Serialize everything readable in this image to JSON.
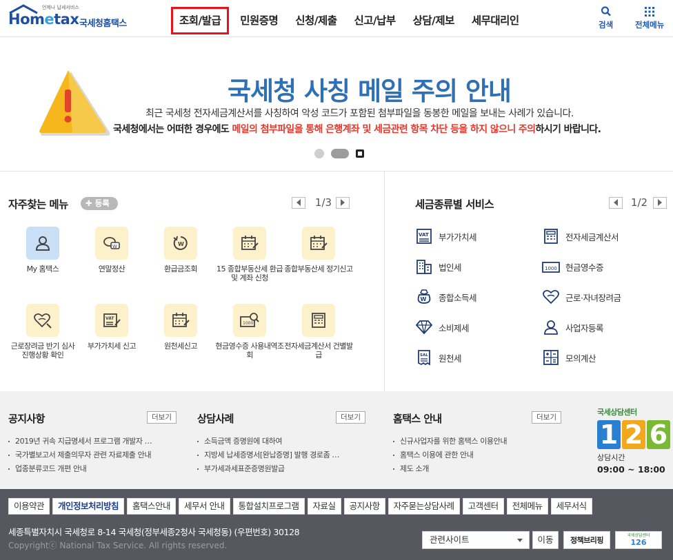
{
  "header": {
    "logo_small": "언제나 납세서비스",
    "logo_main_a": "Hom",
    "logo_main_e": "e",
    "logo_main_b": "tax",
    "logo_sub": "국세청홈택스",
    "nav": [
      "조회/발급",
      "민원증명",
      "신청/제출",
      "신고/납부",
      "상담/제보",
      "세무대리인"
    ],
    "search_label": "검색",
    "menu_label": "전체메뉴"
  },
  "banner": {
    "title": "국세청 사칭 메일 주의 안내",
    "text1": "최근 국세청 전자세금계산서를 사칭하여 악성 코드가 포함된 첨부파일을 동봉한 메일을 보내는 사례가 있습니다.",
    "text2_a": "국세청에서는 어떠한 경우에도 ",
    "text2_red": "메일의 첨부파일을 통해 은행계좌 및 세금관련 항목 차단 등을 하지 않으니 주의",
    "text2_b": "하시기 바랍니다."
  },
  "favorites": {
    "title": "자주찾는 메뉴",
    "register_label": "등록",
    "page": "1/3",
    "items": [
      {
        "label": "My 홈택스",
        "icon": "user-icon"
      },
      {
        "label": "연말정산",
        "icon": "won-speech-icon"
      },
      {
        "label": "환급금조회",
        "icon": "refund-icon"
      },
      {
        "label": "15 종합부동산세 환급 및 계좌 신청",
        "icon": "calendar-icon"
      },
      {
        "label": "종합부동산세 정기신고",
        "icon": "calendar-icon"
      },
      {
        "label": "근로장려금 반기 심사 진행상황 확인",
        "icon": "heart-icon"
      },
      {
        "label": "부가가치세 신고",
        "icon": "vat-icon"
      },
      {
        "label": "원천세신고",
        "icon": "calendar-icon"
      },
      {
        "label": "현금영수증 사용내역조회",
        "icon": "receipt-search-icon"
      },
      {
        "label": "전자세금계산서 건별발급",
        "icon": "invoice-icon"
      }
    ]
  },
  "tax_services": {
    "title": "세금종류별 서비스",
    "page": "1/2",
    "items": [
      {
        "label": "부가가치세",
        "icon": "vat-icon"
      },
      {
        "label": "전자세금계산서",
        "icon": "invoice-icon"
      },
      {
        "label": "법인세",
        "icon": "building-icon"
      },
      {
        "label": "현금영수증",
        "icon": "cash-receipt-icon"
      },
      {
        "label": "종합소득세",
        "icon": "money-bag-icon"
      },
      {
        "label": "근로·자녀장려금",
        "icon": "heart-icon"
      },
      {
        "label": "소비제세",
        "icon": "diamond-icon"
      },
      {
        "label": "사업자등록",
        "icon": "person-icon"
      },
      {
        "label": "원천세",
        "icon": "sale-receipt-icon"
      },
      {
        "label": "모의계산",
        "icon": "calculator-icon"
      }
    ]
  },
  "notices": {
    "more_label": "더보기",
    "sections": [
      {
        "title": "공지사항",
        "items": [
          "2019년 귀속 지급명세서 프로그램 개발자 …",
          "국가별보고서 제출의무자 관련 자료제출 안내",
          "업종분류코드 개편 안내"
        ]
      },
      {
        "title": "상담사례",
        "items": [
          "소득금액 증명원에 대하여",
          "지방세 납세증명서[완납증명] 발행 경로좀 …",
          "부가세과세표준증명원발급"
        ]
      },
      {
        "title": "홈택스 안내",
        "items": [
          "신규사업자를 위한 홈택스 이용안내",
          "홈택스 이용에 관한 안내",
          "제도 소개"
        ]
      }
    ],
    "call_center": {
      "title": "국세상담센터",
      "digits": [
        "1",
        "2",
        "6"
      ],
      "hours_label": "상담시간",
      "hours": "09:00 ~ 18:00"
    }
  },
  "footer": {
    "nav": [
      "이용약관",
      "개인정보처리방침",
      "홈택스안내",
      "세무서 안내",
      "통합설치프로그램",
      "자료실",
      "공지사항",
      "자주묻는상담사례",
      "고객센터",
      "전체메뉴",
      "세무서식"
    ],
    "address": "세종특별자치시 국세청로 8-14 국세청(정부세종2청사 국세청동) (우편번호) 30128",
    "copyright": "Copyrightⓒ National Tax Service. All rights reserved.",
    "related_sites": "관련사이트",
    "go_label": "이동",
    "banner1": "정책브리핑",
    "banner2_title": "국세상담센터",
    "banner2_num": "126"
  }
}
